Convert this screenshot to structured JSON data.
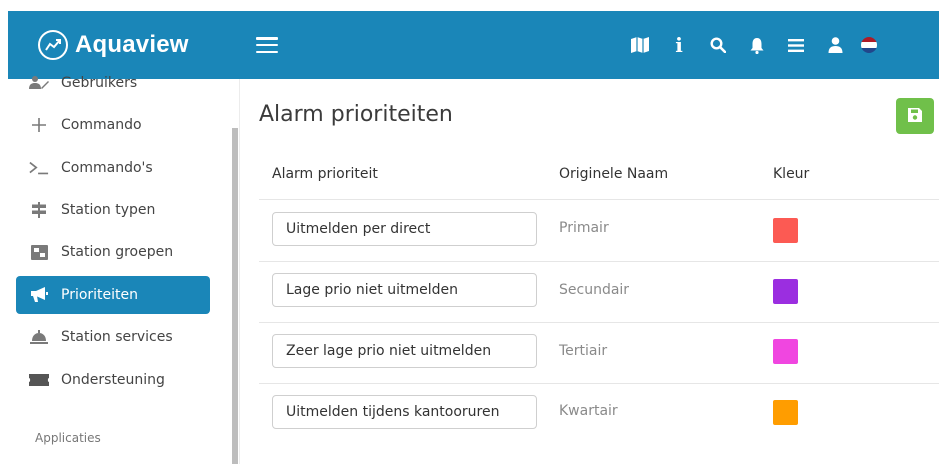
{
  "header": {
    "brand": "Aquaview",
    "icons": [
      "map-icon",
      "info-icon",
      "search-icon",
      "bell-icon",
      "list-icon",
      "user-icon",
      "flag-nl-icon"
    ],
    "color": "#1a86b8"
  },
  "sidebar": {
    "items": [
      {
        "label": "Gebruikers",
        "icon": "users-icon"
      },
      {
        "label": "Commando",
        "icon": "plus-icon"
      },
      {
        "label": "Commando's",
        "icon": "terminal-icon"
      },
      {
        "label": "Station typen",
        "icon": "signpost-icon"
      },
      {
        "label": "Station groepen",
        "icon": "group-icon"
      },
      {
        "label": "Prioriteiten",
        "icon": "megaphone-icon",
        "active": true
      },
      {
        "label": "Station services",
        "icon": "bell-service-icon"
      },
      {
        "label": "Ondersteuning",
        "icon": "ticket-icon"
      }
    ],
    "section": "Applicaties"
  },
  "main": {
    "title": "Alarm prioriteiten",
    "save_icon": "save-icon",
    "columns": [
      "Alarm prioriteit",
      "Originele Naam",
      "Kleur"
    ],
    "rows": [
      {
        "priority": "Uitmelden per direct",
        "original": "Primair",
        "color": "#fc5a53"
      },
      {
        "priority": "Lage prio niet uitmelden",
        "original": "Secundair",
        "color": "#9b2ee0"
      },
      {
        "priority": "Zeer lage prio niet uitmelden",
        "original": "Tertiair",
        "color": "#f046e0"
      },
      {
        "priority": "Uitmelden tijdens kantooruren",
        "original": "Kwartair",
        "color": "#ff9d00"
      }
    ]
  }
}
